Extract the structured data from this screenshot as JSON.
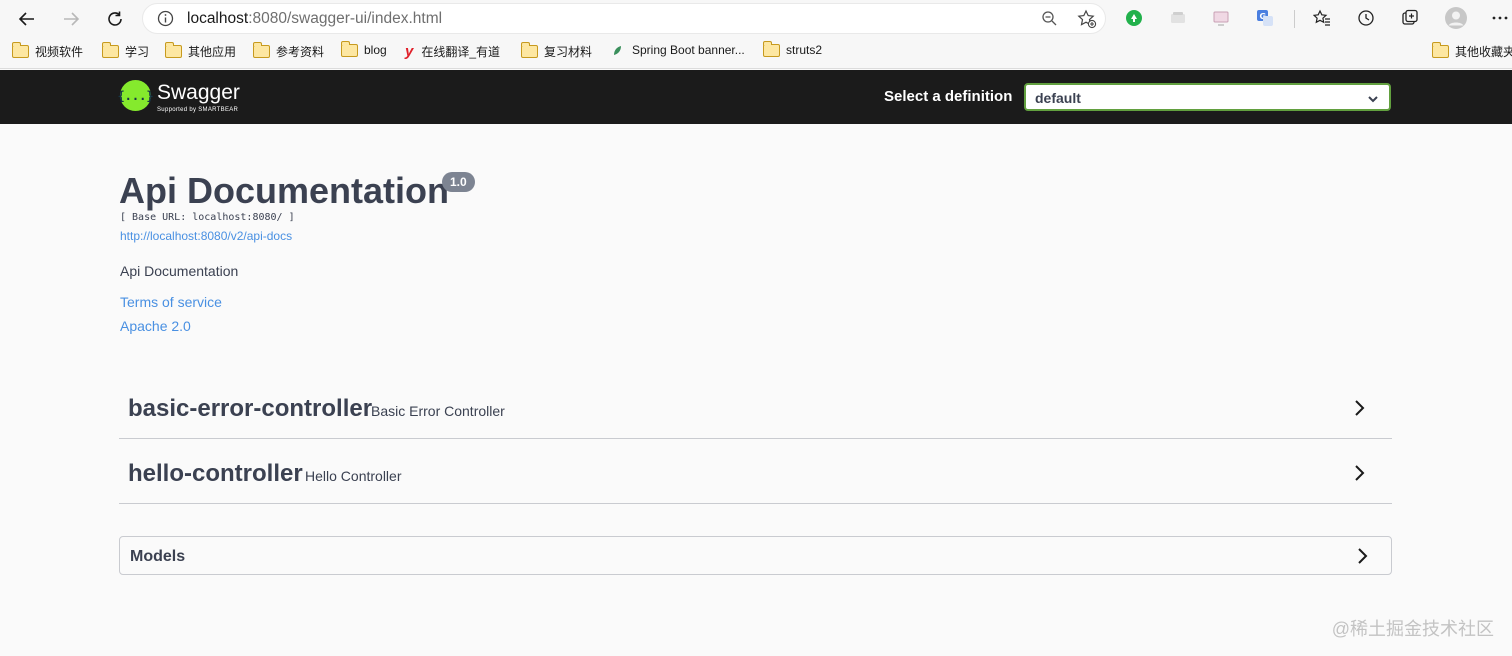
{
  "browser": {
    "url_host": "localhost",
    "url_rest": ":8080/swagger-ui/index.html",
    "bookmarks": [
      {
        "label": "视频软件",
        "icon": "folder-icon"
      },
      {
        "label": "学习",
        "icon": "folder-icon"
      },
      {
        "label": "其他应用",
        "icon": "folder-icon"
      },
      {
        "label": "参考资料",
        "icon": "folder-icon"
      },
      {
        "label": "blog",
        "icon": "folder-icon"
      },
      {
        "label": "在线翻译_有道",
        "icon": "youdao-icon"
      },
      {
        "label": "复习材料",
        "icon": "folder-icon"
      },
      {
        "label": "Spring Boot banner...",
        "icon": "leaf-icon"
      },
      {
        "label": "struts2",
        "icon": "folder-icon"
      }
    ],
    "other_bookmarks": "其他收藏夹"
  },
  "topbar": {
    "logo_text": "Swagger",
    "logo_sub": "Supported by SMARTBEAR",
    "logo_glyph": "{...}",
    "definition_label": "Select a definition",
    "definition_value": "default"
  },
  "info": {
    "title": "Api Documentation",
    "version": "1.0",
    "base_url": "[ Base URL: localhost:8080/ ]",
    "api_docs_link": "http://localhost:8080/v2/api-docs",
    "description": "Api Documentation",
    "terms": "Terms of service",
    "license": "Apache 2.0"
  },
  "controllers": [
    {
      "name": "basic-error-controller",
      "description": "Basic Error Controller"
    },
    {
      "name": "hello-controller",
      "description": "Hello Controller"
    }
  ],
  "models_label": "Models",
  "watermark": "@稀土掘金技术社区",
  "colors": {
    "swagger_green": "#85ea2d",
    "topbar_bg": "#1b1b1b",
    "link_blue": "#4990e2",
    "select_border": "#62a03f"
  }
}
